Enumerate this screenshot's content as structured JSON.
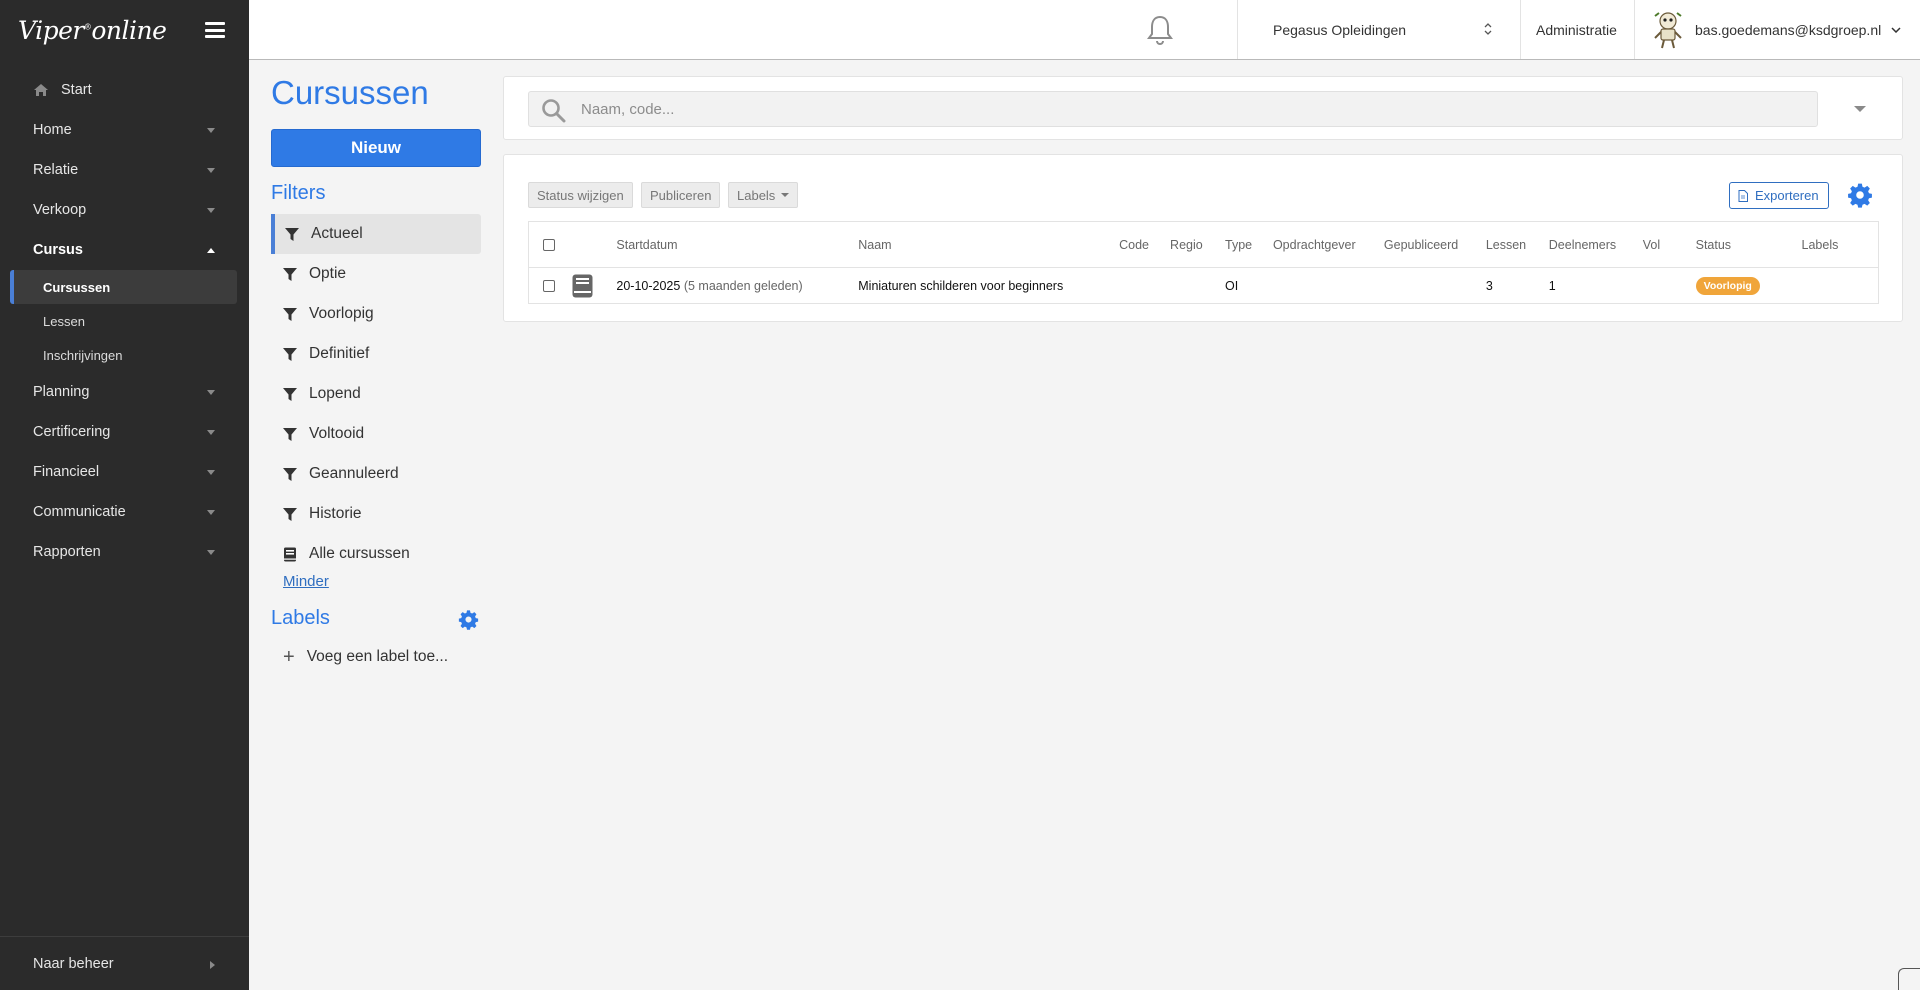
{
  "app": {
    "brand_name": "Viper",
    "brand_mark": "®",
    "brand_suffix": "online"
  },
  "sidebar": {
    "start_label": "Start",
    "items": [
      {
        "label": "Home"
      },
      {
        "label": "Relatie"
      },
      {
        "label": "Verkoop"
      },
      {
        "label": "Cursus",
        "open": true
      }
    ],
    "cursus_sub": [
      {
        "label": "Cursussen",
        "active": true
      },
      {
        "label": "Lessen"
      },
      {
        "label": "Inschrijvingen"
      }
    ],
    "items_after": [
      {
        "label": "Planning"
      },
      {
        "label": "Certificering"
      },
      {
        "label": "Financieel"
      },
      {
        "label": "Communicatie"
      },
      {
        "label": "Rapporten"
      }
    ],
    "footer_label": "Naar beheer"
  },
  "topbar": {
    "organization": "Pegasus Opleidingen",
    "admin_label": "Administratie",
    "user_email": "bas.goedemans@ksdgroep.nl"
  },
  "page": {
    "title": "Cursussen",
    "new_button": "Nieuw",
    "filters_title": "Filters",
    "filters": [
      "Actueel",
      "Optie",
      "Voorlopig",
      "Definitief",
      "Lopend",
      "Voltooid",
      "Geannuleerd",
      "Historie"
    ],
    "all_courses_label": "Alle cursussen",
    "less_link": "Minder",
    "labels_title": "Labels",
    "add_label": "Voeg een label toe..."
  },
  "search": {
    "placeholder": "Naam, code..."
  },
  "toolbar": {
    "status_change": "Status wijzigen",
    "publish": "Publiceren",
    "labels": "Labels",
    "export": "Exporteren"
  },
  "table": {
    "columns": [
      "Startdatum",
      "Naam",
      "Code",
      "Regio",
      "Type",
      "Opdrachtgever",
      "Gepubliceerd",
      "Lessen",
      "Deelnemers",
      "Vol",
      "Status",
      "Labels"
    ],
    "rows": [
      {
        "start_date": "20-10-2025",
        "start_ago": "(5 maanden geleden)",
        "name": "Miniaturen schilderen voor beginners",
        "code": "",
        "region": "",
        "type": "OI",
        "client": "",
        "published": "",
        "lessons": "3",
        "participants": "1",
        "full": "",
        "status": "Voorlopig",
        "labels": ""
      }
    ]
  },
  "colors": {
    "accent": "#2f7ae5",
    "sidebar_bg": "#2b2b2b",
    "status_badge": "#f0a53a",
    "active_marker": "#4a7fd6"
  }
}
